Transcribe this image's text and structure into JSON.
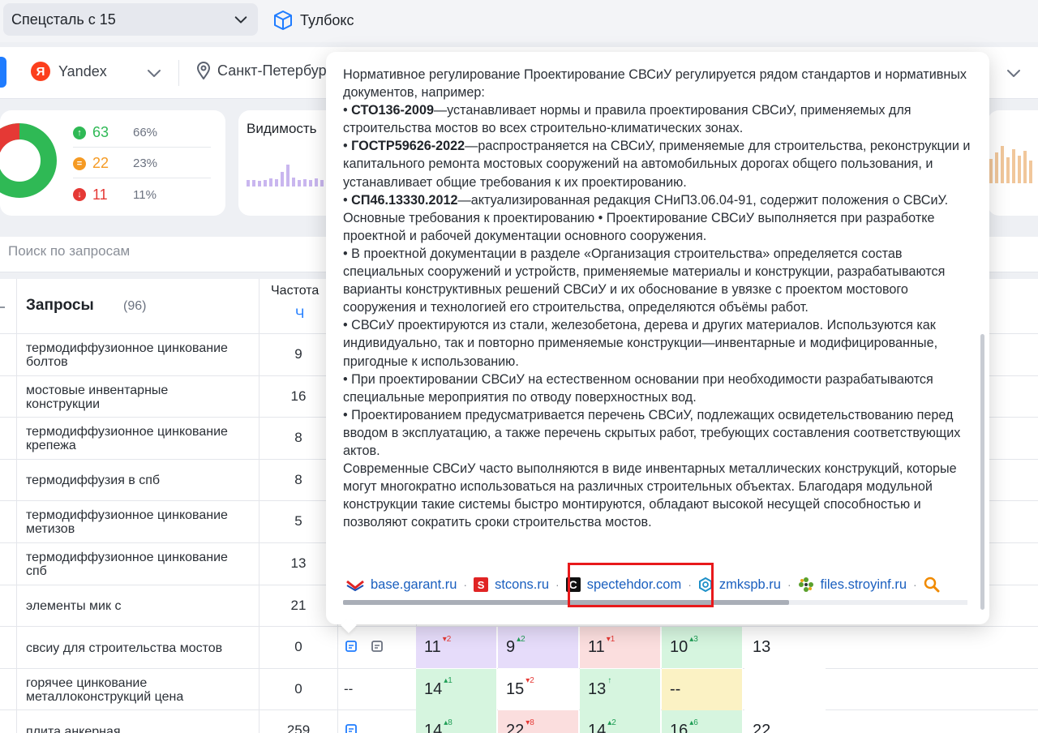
{
  "topbar": {
    "project": "Спецсталь с 15",
    "toolbox": "Тулбокс"
  },
  "filters": {
    "engine": "Yandex",
    "engine_logo": "Я",
    "region": "Санкт-Петербург"
  },
  "stats": {
    "rows": [
      {
        "value": "63",
        "pct": "66%",
        "color": "#2fb955",
        "icon": "arrow-up-icon"
      },
      {
        "value": "22",
        "pct": "23%",
        "color": "#f59a23",
        "icon": "equal-icon"
      },
      {
        "value": "11",
        "pct": "11%",
        "color": "#e53935",
        "icon": "arrow-down-icon"
      }
    ]
  },
  "visibility": {
    "title": "Видимость"
  },
  "search": {
    "placeholder": "Поиск по запросам"
  },
  "table": {
    "header": {
      "queries": "Запросы",
      "count": "(96)",
      "freq": "Частота",
      "freq_sub": "Ч"
    },
    "rows": [
      {
        "q": "термодиффузионное цинкование болтов",
        "f": "9"
      },
      {
        "q": "мостовые инвентарные конструкции",
        "f": "16"
      },
      {
        "q": "термодиффузионное цинкование крепежа",
        "f": "8"
      },
      {
        "q": "термодиффузия в спб",
        "f": "8"
      },
      {
        "q": "термодиффузионное цинкование метизов",
        "f": "5"
      },
      {
        "q": "термодиффузионное цинкование спб",
        "f": "13"
      },
      {
        "q": "элементы мик с",
        "f": "21"
      },
      {
        "q": "свсиу для строительства мостов",
        "f": "0"
      },
      {
        "q": "горячее цинкование металлоконструкций цена",
        "f": "0"
      },
      {
        "q": "плита анкерная",
        "f": "259"
      }
    ],
    "pos_rows": [
      {
        "dash": "",
        "cells": [
          {
            "v": "11",
            "d": "▾2",
            "dir": "dn",
            "bg": "#e6dcfa"
          },
          {
            "v": "9",
            "d": "▴2",
            "dir": "up",
            "bg": "#e6dcfa"
          },
          {
            "v": "11",
            "d": "▾1",
            "dir": "dn",
            "bg": "#fbdede"
          },
          {
            "v": "10",
            "d": "▴3",
            "dir": "up",
            "bg": "#d6f5df"
          },
          {
            "v": "13",
            "d": "",
            "dir": "",
            "bg": "#ffffff"
          }
        ]
      },
      {
        "dash": "--",
        "cells": [
          {
            "v": "14",
            "d": "▴1",
            "dir": "up",
            "bg": "#d6f5df"
          },
          {
            "v": "15",
            "d": "▾2",
            "dir": "dn",
            "bg": "#ffffff"
          },
          {
            "v": "13",
            "d": "↑",
            "dir": "up",
            "bg": "#d6f5df"
          },
          {
            "v": "--",
            "d": "",
            "dir": "",
            "bg": "#fbf2c4"
          },
          {
            "v": "",
            "d": "",
            "dir": "",
            "bg": "#ffffff"
          }
        ]
      },
      {
        "dash": "",
        "cells": [
          {
            "v": "14",
            "d": "▴8",
            "dir": "up",
            "bg": "#d6f5df"
          },
          {
            "v": "22",
            "d": "▾8",
            "dir": "dn",
            "bg": "#fbdede"
          },
          {
            "v": "14",
            "d": "▴2",
            "dir": "up",
            "bg": "#d6f5df"
          },
          {
            "v": "16",
            "d": "▴6",
            "dir": "up",
            "bg": "#d6f5df"
          },
          {
            "v": "22",
            "d": "",
            "dir": "",
            "bg": "#ffffff"
          }
        ]
      }
    ]
  },
  "popup": {
    "p1": "Нормативное регулирование Проектирование СВСиУ регулируется рядом стандартов и нормативных документов, например:",
    "items": [
      {
        "code": "СТО136-2009",
        "text": "—устанавливает нормы и правила проектирования СВСиУ, применяемых для строительства мостов во всех строительно-климатических зонах."
      },
      {
        "code": "ГОСТР59626-2022",
        "text": "—распространяется на СВСиУ, применяемые для строительства, реконструкции и капитального ремонта мостовых сооружений на автомобильных дорогах общего пользования, и устанавливает общие требования к их проектированию."
      },
      {
        "code": "СП46.13330.2012",
        "text": "—актуализированная редакция СНиП3.06.04-91, содержит положения о СВСиУ."
      }
    ],
    "p2": "Основные требования к проектированию • Проектирование СВСиУ выполняется при разработке проектной и рабочей документации основного сооружения.",
    "p3": "• В проектной документации в разделе «Организация строительства» определяется состав специальных сооружений и устройств, применяемые материалы и конструкции, разрабатываются варианты конструктивных решений СВСиУ и их обоснование в увязке с проектом мостового сооружения и технологией его строительства, определяются объёмы работ.",
    "p4": "• СВСиУ проектируются из стали, железобетона, дерева и других материалов. Используются как индивидуально, так и повторно применяемые конструкции—инвентарные и модифицированные, пригодные к использованию.",
    "p5": "• При проектировании СВСиУ на естественном основании при необходимости разрабатываются специальные мероприятия по отводу поверхностных вод.",
    "p6": "• Проектированием предусматривается перечень СВСиУ, подлежащих освидетельствованию перед вводом в эксплуатацию, а также перечень скрытых работ, требующих составления соответствующих актов.",
    "p7": "Современные СВСиУ часто выполняются в виде инвентарных металлических конструкций, которые могут многократно использоваться на различных строительных объектах. Благодаря модульной конструкции такие системы быстро монтируются, обладают высокой несущей способностью и позволяют сократить сроки строительства мостов.",
    "sources": [
      {
        "label": "base.garant.ru",
        "icon": "garant-logo-icon"
      },
      {
        "label": "stcons.ru",
        "icon": "stcons-logo-icon"
      },
      {
        "label": "spectehdor.com",
        "icon": "spectehdor-logo-icon"
      },
      {
        "label": "zmkspb.ru",
        "icon": "zmkspb-logo-icon"
      },
      {
        "label": "files.stroyinf.ru",
        "icon": "stroyinf-logo-icon"
      }
    ],
    "spec_letter": "C",
    "stcons_letter": "S"
  }
}
